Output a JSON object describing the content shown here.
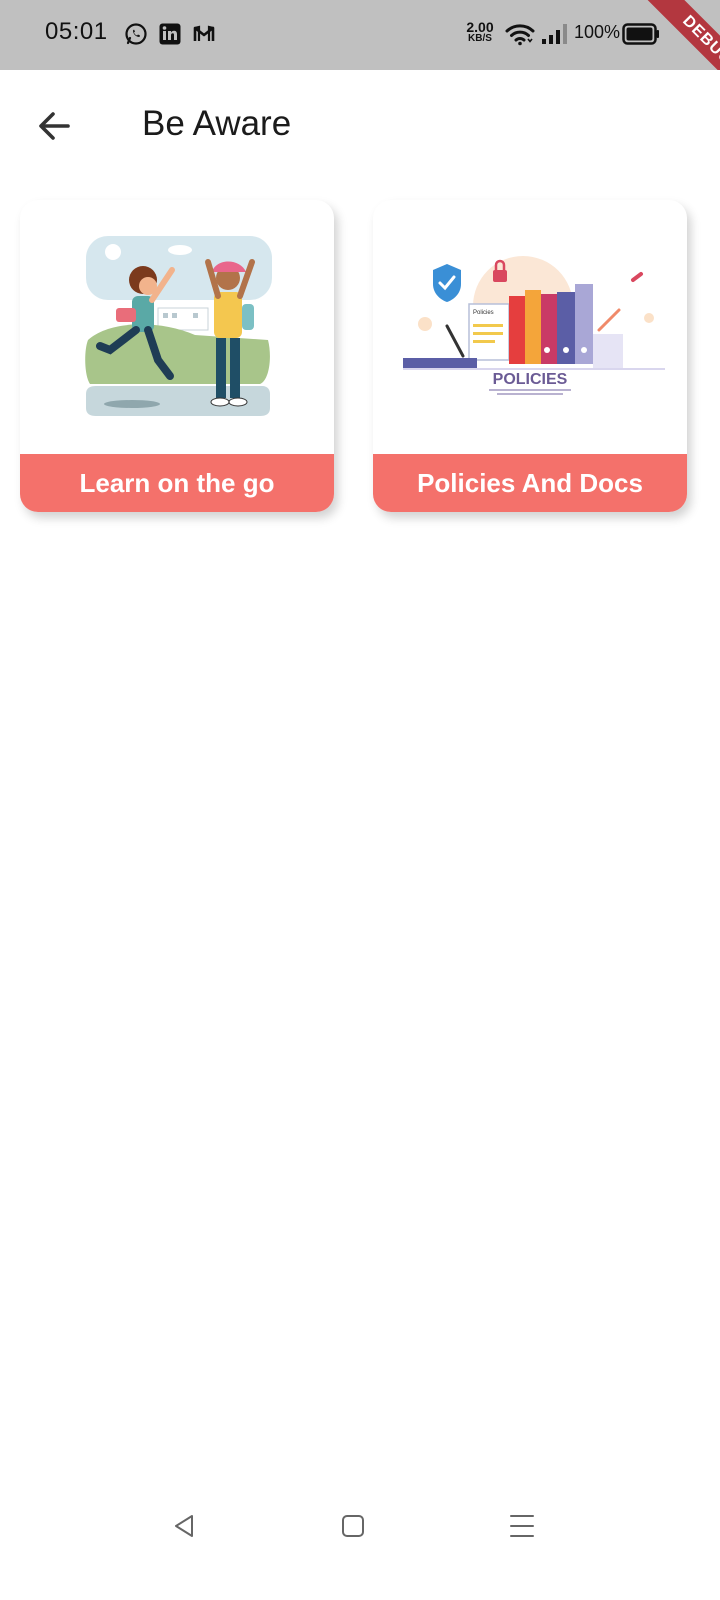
{
  "status_bar": {
    "time": "05:01",
    "app_icons": [
      "whatsapp-icon",
      "linkedin-icon",
      "gmail-icon"
    ],
    "net_speed_value": "2.00",
    "net_speed_unit": "KB/S",
    "battery_percent": "100%"
  },
  "debug_banner": {
    "label": "DEBUG"
  },
  "app_bar": {
    "title": "Be Aware",
    "back_icon": "arrow-left-icon"
  },
  "cards": [
    {
      "label": "Learn on the go",
      "image": "kids-high-five-illustration"
    },
    {
      "label": "Policies And Docs",
      "image": "policies-illustration",
      "image_text": "POLICIES",
      "doc_label": "Policies"
    }
  ],
  "nav_bar": {
    "buttons": [
      "back-triangle-icon",
      "home-square-icon",
      "menu-lines-icon"
    ]
  },
  "colors": {
    "status_bar": "#c0c0c0",
    "card_label_bg": "#f4716b",
    "debug_ribbon": "#b3373f"
  }
}
